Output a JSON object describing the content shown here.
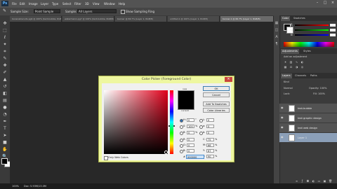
{
  "menubar": {
    "app": "Ps",
    "items": [
      "File",
      "Edit",
      "Image",
      "Layer",
      "Type",
      "Select",
      "Filter",
      "3D",
      "View",
      "Window",
      "Help"
    ]
  },
  "options": {
    "sample_size_label": "Sample Size:",
    "sample_size_value": "Point Sample",
    "sample_label": "Sample:",
    "sample_value": "All Layers",
    "show_ring": "Show Sampling Ring"
  },
  "tabs": [
    "bananabiscuits-pg9 @ 100% (text-bubble, RGB/8)",
    "watermelon-pg7 @ 100% (text-bubble, RGB/8)",
    "banner @ 66.7% (Layer 1, RGB/8)",
    "untitled-1 @ 100% (Layer 1, RGB/8)",
    "banner-1 @ 66.7% (Layer 1, RGB/8)"
  ],
  "right_panel": {
    "color_tab": "Color",
    "swatches_tab": "Swatches",
    "sliders": [
      {
        "label": "R",
        "color": "#e04040"
      },
      {
        "label": "G",
        "color": "#40c040"
      },
      {
        "label": "B",
        "color": "#4070e0"
      }
    ],
    "adjustments_tab": "Adjustments",
    "styles_tab": "Styles",
    "add_adjustment": "Add an adjustment",
    "layers_tab": "Layers",
    "channels_tab": "Channels",
    "paths_tab": "Paths",
    "kind_label": "Kind",
    "blend_mode": "Normal",
    "opacity_label": "Opacity: 100%",
    "lock_label": "Lock:",
    "fill_label": "Fill: 100%",
    "layers": [
      {
        "name": "text-bubble",
        "selected": false
      },
      {
        "name": "text graphic design",
        "selected": false
      },
      {
        "name": "text web design",
        "selected": false
      },
      {
        "name": "Layer 1",
        "selected": true
      }
    ]
  },
  "dialog": {
    "title": "Color Picker (Foreground Color)",
    "new_label": "new",
    "current_label": "current",
    "ok": "OK",
    "cancel": "Cancel",
    "add_to_swatches": "Add To Swatches",
    "color_libraries": "Color Libraries",
    "only_web_colors": "Only Web Colors",
    "hsb": [
      {
        "label": "H:",
        "value": "0",
        "unit": "°",
        "checked": true
      },
      {
        "label": "S:",
        "value": "100",
        "unit": "%",
        "checked": false
      },
      {
        "label": "B:",
        "value": "0",
        "unit": "%",
        "checked": false
      }
    ],
    "rgb": [
      {
        "label": "R:",
        "value": "0",
        "checked": false
      },
      {
        "label": "G:",
        "value": "0",
        "checked": false
      },
      {
        "label": "B:",
        "value": "0",
        "checked": false
      }
    ],
    "lab": [
      {
        "label": "L:",
        "value": "0"
      },
      {
        "label": "a:",
        "value": "0"
      },
      {
        "label": "b:",
        "value": "0"
      }
    ],
    "cmyk": [
      {
        "label": "C:",
        "value": "75",
        "unit": "%"
      },
      {
        "label": "M:",
        "value": "68",
        "unit": "%"
      },
      {
        "label": "Y:",
        "value": "67",
        "unit": "%"
      },
      {
        "label": "K:",
        "value": "90",
        "unit": "%"
      }
    ],
    "hex_label": "#",
    "hex_value": "000000"
  },
  "statusbar": {
    "zoom": "100%",
    "doc": "Doc: 5.93M/13.0M"
  }
}
